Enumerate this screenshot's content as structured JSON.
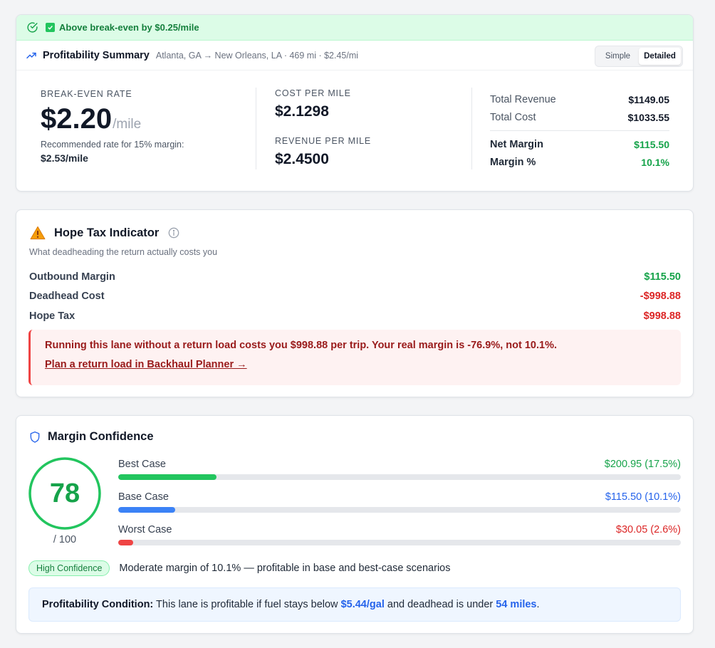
{
  "summary": {
    "banner_text": "Above break-even by $0.25/mile",
    "title": "Profitability Summary",
    "route": "Atlanta, GA → New Orleans, LA · 469 mi · $2.45/mi",
    "view_toggle": {
      "simple_label": "Simple",
      "detailed_label": "Detailed",
      "selected": "Detailed"
    },
    "break_even": {
      "label": "BREAK-EVEN RATE",
      "value": "$2.20",
      "unit": "/mile",
      "recommended_label": "Recommended rate for 15% margin:",
      "recommended_value": "$2.53/mile"
    },
    "cost_per_mile": {
      "label": "COST PER MILE",
      "value": "$2.1298"
    },
    "revenue_per_mile": {
      "label": "REVENUE PER MILE",
      "value": "$2.4500"
    },
    "totals": {
      "total_revenue_label": "Total Revenue",
      "total_revenue": "$1149.05",
      "total_cost_label": "Total Cost",
      "total_cost": "$1033.55",
      "net_margin_label": "Net Margin",
      "net_margin": "$115.50",
      "margin_pct_label": "Margin %",
      "margin_pct": "10.1%"
    }
  },
  "hope_tax": {
    "title": "Hope Tax Indicator",
    "subtitle": "What deadheading the return actually costs you",
    "rows": [
      {
        "label": "Outbound Margin",
        "value": "$115.50"
      },
      {
        "label": "Deadhead Cost",
        "value": "-$998.88"
      },
      {
        "label": "Hope Tax",
        "value": "$998.88"
      }
    ],
    "alert_text": "Running this lane without a return load costs you $998.88 per trip. Your real margin is -76.9%, not 10.1%.",
    "alert_link": "Plan a return load in Backhaul Planner →"
  },
  "confidence": {
    "title": "Margin Confidence",
    "score": "78",
    "score_value": 78,
    "score_max": "/ 100",
    "scenarios": [
      {
        "label": "Best Case",
        "value": "$200.95 (17.5%)",
        "fill": 0.175,
        "color": "#22c55e"
      },
      {
        "label": "Base Case",
        "value": "$115.50 (10.1%)",
        "fill": 0.101,
        "color": "#3b82f6"
      },
      {
        "label": "Worst Case",
        "value": "$30.05 (2.6%)",
        "fill": 0.026,
        "color": "#ef4444"
      }
    ],
    "badge": "High Confidence",
    "badge_desc": "Moderate margin of 10.1% — profitable in base and best-case scenarios",
    "condition": {
      "label": "Profitability Condition:",
      "text_1": "This lane is profitable if fuel stays below",
      "fuel": "$5.44/gal",
      "text_2": "and deadhead is under",
      "deadhead": "54 miles",
      "text_3": "."
    }
  },
  "colors": {
    "green": "#16a34a",
    "red": "#dc2626",
    "blue": "#2563eb",
    "banner_bg": "#dcfce7"
  }
}
